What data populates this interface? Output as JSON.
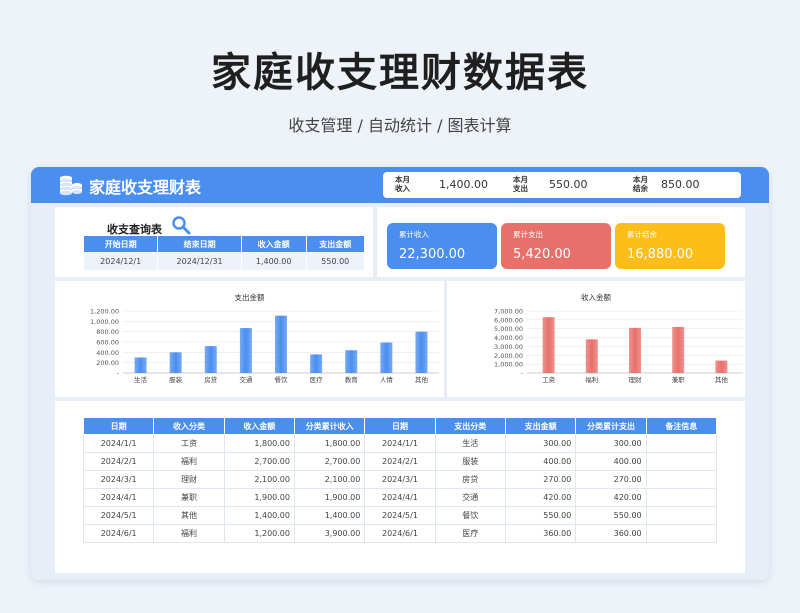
{
  "header": {
    "title": "家庭收支理财数据表",
    "subtitle": "收支管理 / 自动统计 / 图表计算"
  },
  "app": {
    "title": "家庭收支理财表",
    "summary": [
      {
        "label": "本月收入",
        "value": "1,400.00"
      },
      {
        "label": "本月支出",
        "value": "550.00"
      },
      {
        "label": "本月结余",
        "value": "850.00"
      }
    ]
  },
  "query": {
    "title": "收支查询表",
    "headers": [
      "开始日期",
      "结束日期",
      "收入金额",
      "支出金额"
    ],
    "row": [
      "2024/12/1",
      "2024/12/31",
      "1,400.00",
      "550.00"
    ]
  },
  "kpis": [
    {
      "label": "累计收入",
      "value": "22,300.00",
      "color": "#4a8ef0"
    },
    {
      "label": "累计支出",
      "value": "5,420.00",
      "color": "#e8706a"
    },
    {
      "label": "累计结余",
      "value": "16,880.00",
      "color": "#fdbe1a"
    }
  ],
  "chart_data": [
    {
      "type": "bar",
      "title": "支出金额",
      "categories": [
        "生活",
        "服装",
        "房贷",
        "交通",
        "餐饮",
        "医疗",
        "教育",
        "人情",
        "其他"
      ],
      "values": [
        300,
        400,
        520,
        870,
        1110,
        360,
        440,
        590,
        800
      ],
      "ylim": [
        0,
        1200
      ],
      "yticks": [
        "1,200.00",
        "1,000.00",
        "800.00",
        "600.00",
        "400.00",
        "200.00",
        "-"
      ],
      "color": "#4a8ef0"
    },
    {
      "type": "bar",
      "title": "收入金额",
      "categories": [
        "工资",
        "福利",
        "理财",
        "兼职",
        "其他"
      ],
      "values": [
        6300,
        3800,
        5100,
        5200,
        1400
      ],
      "ylim": [
        0,
        7000
      ],
      "yticks": [
        "7,000.00",
        "6,000.00",
        "5,000.00",
        "4,000.00",
        "3,000.00",
        "2,000.00",
        "1,000.00",
        "-"
      ],
      "color": "#e8706a"
    }
  ],
  "records": {
    "headers": [
      "日期",
      "收入分类",
      "收入金额",
      "分类累计收入",
      "日期",
      "支出分类",
      "支出金额",
      "分类累计支出",
      "备注信息"
    ],
    "rows": [
      [
        "2024/1/1",
        "工资",
        "1,800.00",
        "1,800.00",
        "2024/1/1",
        "生活",
        "300.00",
        "300.00",
        ""
      ],
      [
        "2024/2/1",
        "福利",
        "2,700.00",
        "2,700.00",
        "2024/2/1",
        "服装",
        "400.00",
        "400.00",
        ""
      ],
      [
        "2024/3/1",
        "理财",
        "2,100.00",
        "2,100.00",
        "2024/3/1",
        "房贷",
        "270.00",
        "270.00",
        ""
      ],
      [
        "2024/4/1",
        "兼职",
        "1,900.00",
        "1,900.00",
        "2024/4/1",
        "交通",
        "420.00",
        "420.00",
        ""
      ],
      [
        "2024/5/1",
        "其他",
        "1,400.00",
        "1,400.00",
        "2024/5/1",
        "餐饮",
        "550.00",
        "550.00",
        ""
      ],
      [
        "2024/6/1",
        "福利",
        "1,200.00",
        "3,900.00",
        "2024/6/1",
        "医疗",
        "360.00",
        "360.00",
        ""
      ]
    ]
  }
}
